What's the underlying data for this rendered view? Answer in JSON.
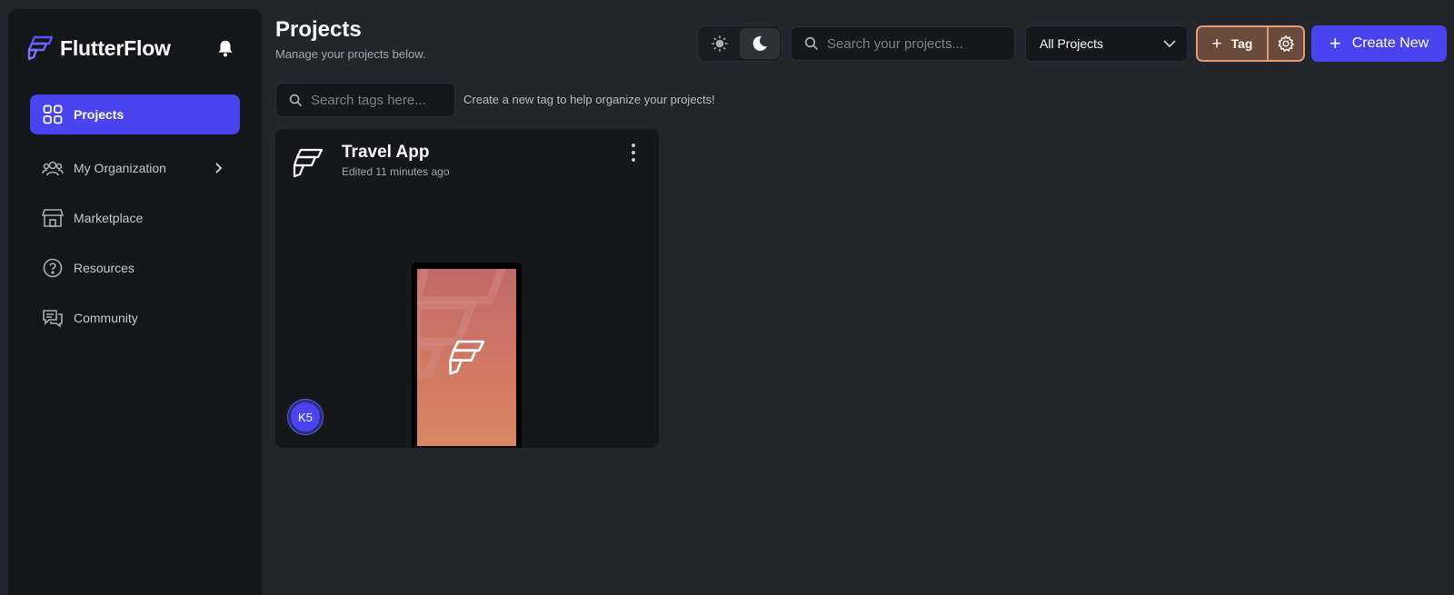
{
  "app": {
    "name": "FlutterFlow"
  },
  "sidebar": {
    "items": [
      {
        "label": "Projects",
        "icon": "grid-icon",
        "active": true
      },
      {
        "label": "My Organization",
        "icon": "people-icon",
        "has_submenu": true
      },
      {
        "label": "Marketplace",
        "icon": "store-icon"
      },
      {
        "label": "Resources",
        "icon": "help-circle-icon"
      },
      {
        "label": "Community",
        "icon": "chat-icon"
      }
    ]
  },
  "header": {
    "title": "Projects",
    "subtitle": "Manage your projects below.",
    "search_placeholder": "Search your projects...",
    "filter_selected": "All Projects",
    "tag_label": "Tag",
    "create_label": "Create New"
  },
  "tags": {
    "search_placeholder": "Search tags here...",
    "hint": "Create a new tag to help organize your projects!"
  },
  "projects": [
    {
      "name": "Travel App",
      "edited": "Edited 11 minutes ago",
      "avatar": "K5"
    }
  ],
  "colors": {
    "accent": "#4a44f0",
    "tag_border": "#e39a76",
    "background": "#22252b",
    "sidebar": "#141619"
  }
}
